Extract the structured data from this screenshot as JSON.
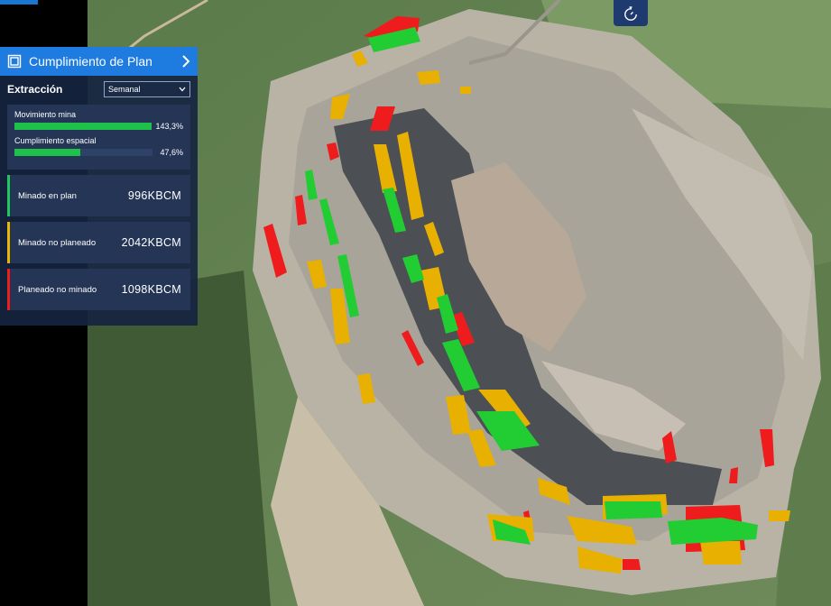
{
  "panel": {
    "title": "Cumplimiento de Plan",
    "section_label": "Extracción",
    "period_select": {
      "value": "Semanal"
    },
    "metrics": [
      {
        "label": "Movimiento mina",
        "value": "143,3%",
        "fill_percent": 100
      },
      {
        "label": "Cumplimiento espacial",
        "value": "47,6%",
        "fill_percent": 47.6
      }
    ],
    "stats": [
      {
        "label": "Minado en plan",
        "value": "996KBCM",
        "color": "#22c55e"
      },
      {
        "label": "Minado no planeado",
        "value": "2042KBCM",
        "color": "#eab308"
      },
      {
        "label": "Planeado no minado",
        "value": "1098KBCM",
        "color": "#ef1c1c"
      }
    ]
  },
  "toolbar": {
    "timer_icon": "stopwatch-icon"
  },
  "map": {
    "legend_colors": {
      "planned_mined": "#22cc33",
      "unplanned_mined": "#e8b000",
      "planned_not_mined": "#ee1c1c"
    }
  }
}
